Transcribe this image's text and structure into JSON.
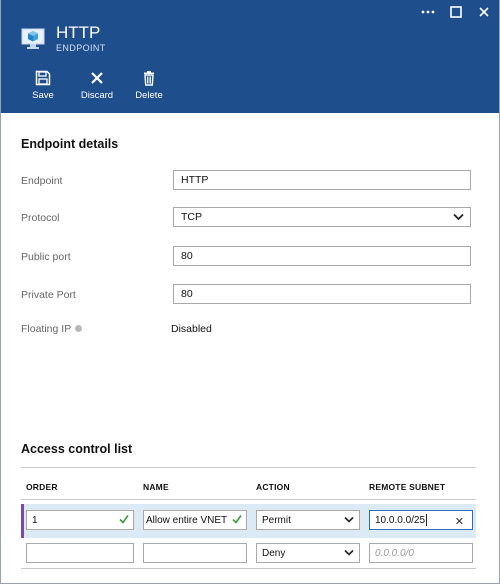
{
  "window": {
    "controls": [
      {
        "name": "more-icon",
        "glyph": "•••"
      },
      {
        "name": "maximize-icon",
        "glyph": "☐"
      },
      {
        "name": "close-icon",
        "glyph": "✕"
      }
    ]
  },
  "header": {
    "title": "HTTP",
    "subtitle": "ENDPOINT",
    "icon": "cube-monitor-icon",
    "bg_color": "#1f4e8c"
  },
  "toolbar": {
    "save_label": "Save",
    "discard_label": "Discard",
    "delete_label": "Delete"
  },
  "endpoint_details": {
    "section_title": "Endpoint details",
    "endpoint_label": "Endpoint",
    "endpoint_value": "HTTP",
    "protocol_label": "Protocol",
    "protocol_value": "TCP",
    "public_port_label": "Public port",
    "public_port_value": "80",
    "private_port_label": "Private Port",
    "private_port_value": "80",
    "floating_ip_label": "Floating IP",
    "floating_ip_value": "Disabled"
  },
  "acl": {
    "section_title": "Access control list",
    "columns": [
      "ORDER",
      "NAME",
      "ACTION",
      "REMOTE SUBNET"
    ],
    "rows": [
      {
        "order": "1",
        "name": "Allow entire VNET",
        "action": "Permit",
        "remote_subnet": "10.0.0.0/25"
      },
      {
        "order": "",
        "name": "",
        "action": "Deny",
        "remote_subnet": ""
      }
    ],
    "remote_subnet_placeholder": "0.0.0.0/0",
    "accent_color": "#7a4ba8",
    "selected_row_color": "#dbeaf4"
  }
}
